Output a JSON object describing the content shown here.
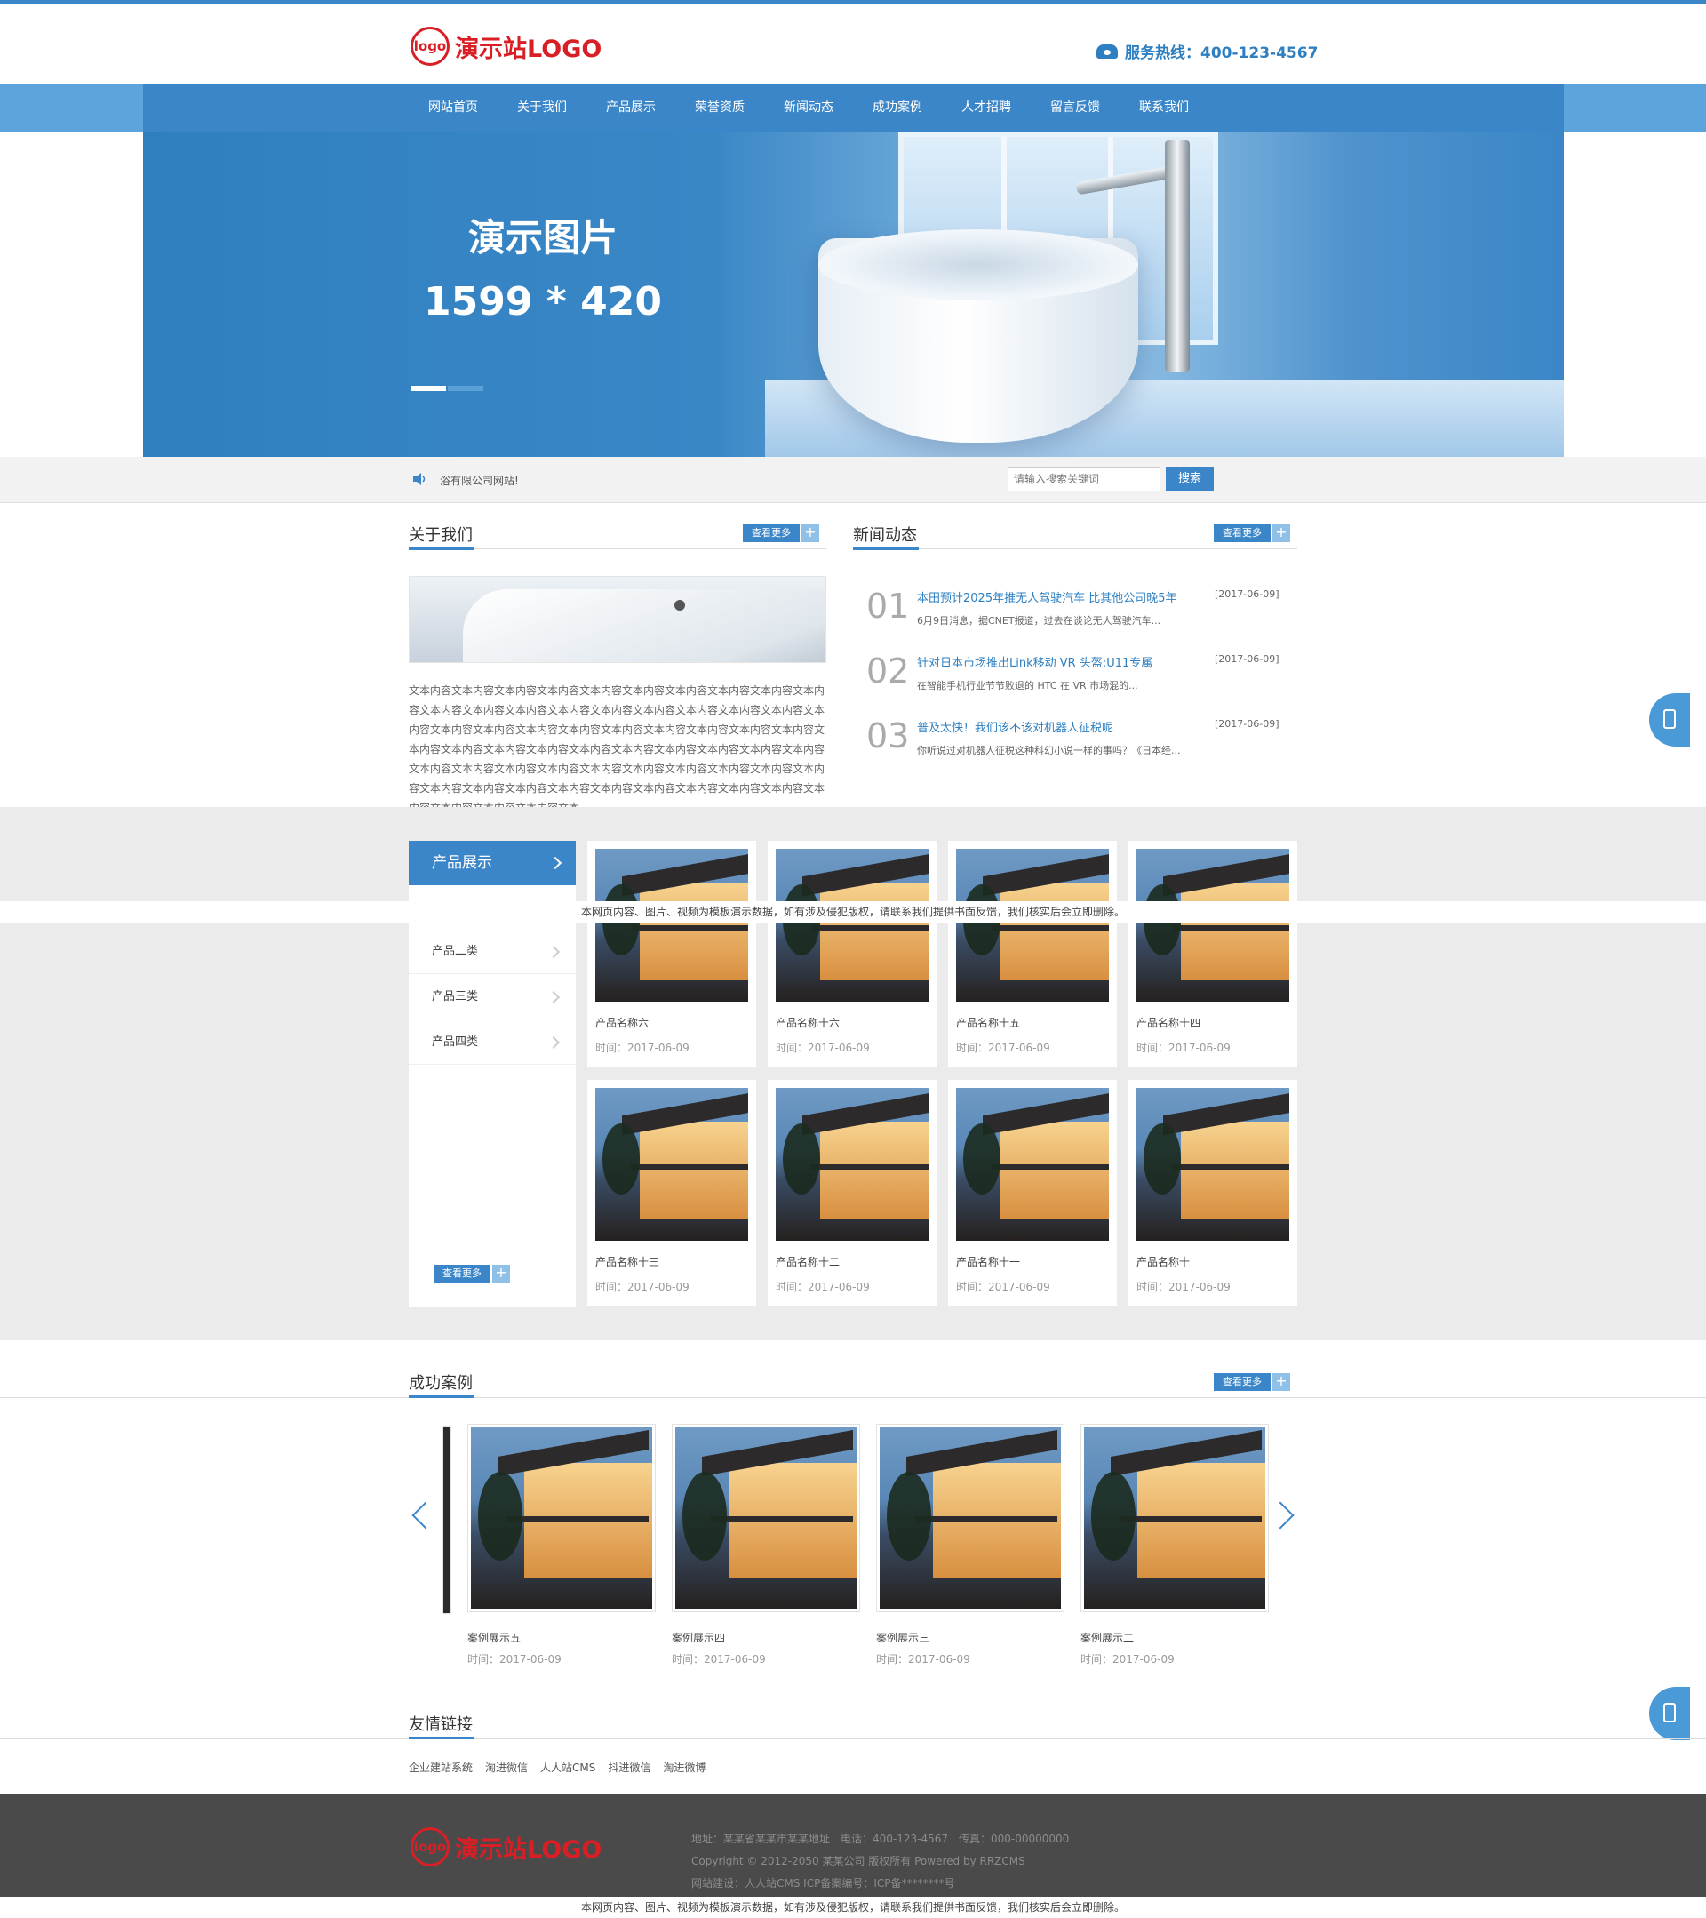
{
  "header": {
    "logo_mark": "logo",
    "logo_text": "演示站LOGO",
    "hotline": "服务热线：400-123-4567"
  },
  "nav": [
    "网站首页",
    "关于我们",
    "产品展示",
    "荣誉资质",
    "新闻动态",
    "成功案例",
    "人才招聘",
    "留言反馈",
    "联系我们"
  ],
  "banner": {
    "title": "演示图片",
    "size": "1599 * 420",
    "slides": 2,
    "active_slide": 1
  },
  "notice": {
    "text": "浴有限公司网站!"
  },
  "search": {
    "placeholder": "请输入搜索关键词",
    "button": "搜索"
  },
  "more_label": "查看更多",
  "more_plus": "+",
  "about": {
    "title": "关于我们",
    "text": "文本内容文本内容文本内容文本内容文本内容文本内容文本内容文本内容文本内容文本内容文本内容文本内容文本内容文本内容文本内容文本内容文本内容文本内容文本内容文本内容文本内容文本内容文本内容文本内容文本内容文本内容文本内容文本内容文本内容文本内容文本内容文本内容文本内容文本内容文本内容文本内容文本内容文本内容文本内容文本内容文本内容文本内容文本内容文本内容文本内容文本内容文本内容文本内容文本内容文本内容文本内容文本内容文本内容文本内容文本内容文本内容文本内容文本内容文本内容文本内容文本内容文本内容文本..."
  },
  "news": {
    "title": "新闻动态",
    "items": [
      {
        "num": "01",
        "title": "本田预计2025年推无人驾驶汽车 比其他公司晚5年",
        "date": "[2017-06-09]",
        "desc": "6月9日消息，据CNET报道，过去在谈论无人驾驶汽车..."
      },
      {
        "num": "02",
        "title": "针对日本市场推出Link移动 VR 头盔:U11专属",
        "date": "[2017-06-09]",
        "desc": "在智能手机行业节节败退的 HTC 在 VR 市场混的..."
      },
      {
        "num": "03",
        "title": "普及太快！我们该不该对机器人征税呢",
        "date": "[2017-06-09]",
        "desc": "你听说过对机器人征税这种科幻小说一样的事吗？《日本经..."
      }
    ]
  },
  "products": {
    "title": "产品展示",
    "categories": [
      "产品二类",
      "产品三类",
      "产品四类"
    ],
    "items": [
      {
        "name": "产品名称六",
        "time": "时间：2017-06-09"
      },
      {
        "name": "产品名称十六",
        "time": "时间：2017-06-09"
      },
      {
        "name": "产品名称十五",
        "time": "时间：2017-06-09"
      },
      {
        "name": "产品名称十四",
        "time": "时间：2017-06-09"
      },
      {
        "name": "产品名称十三",
        "time": "时间：2017-06-09"
      },
      {
        "name": "产品名称十二",
        "time": "时间：2017-06-09"
      },
      {
        "name": "产品名称十一",
        "time": "时间：2017-06-09"
      },
      {
        "name": "产品名称十",
        "time": "时间：2017-06-09"
      }
    ]
  },
  "cases": {
    "title": "成功案例",
    "items": [
      {
        "name": "案例展示五",
        "time": "时间：2017-06-09"
      },
      {
        "name": "案例展示四",
        "time": "时间：2017-06-09"
      },
      {
        "name": "案例展示三",
        "time": "时间：2017-06-09"
      },
      {
        "name": "案例展示二",
        "time": "时间：2017-06-09"
      }
    ]
  },
  "links": {
    "title": "友情链接",
    "items": [
      "企业建站系统",
      "淘进微信",
      "人人站CMS",
      "抖进微信",
      "淘进微博"
    ]
  },
  "footer": {
    "address": "地址：某某省某某市某某地址　电话：400-123-4567　传真：000-00000000",
    "copyright": "Copyright © 2012-2050 某某公司 版权所有 Powered by RRZCMS",
    "build": "网站建设：人人站CMS ICP备案编号：ICP备********号"
  },
  "disclaimer": "本网页内容、图片、视频为模板演示数据，如有涉及侵犯版权，请联系我们提供书面反馈，我们核实后会立即删除。",
  "colors": {
    "accent": "#3b86c8",
    "logo": "#d81f26",
    "footer": "#4a4a4a"
  }
}
